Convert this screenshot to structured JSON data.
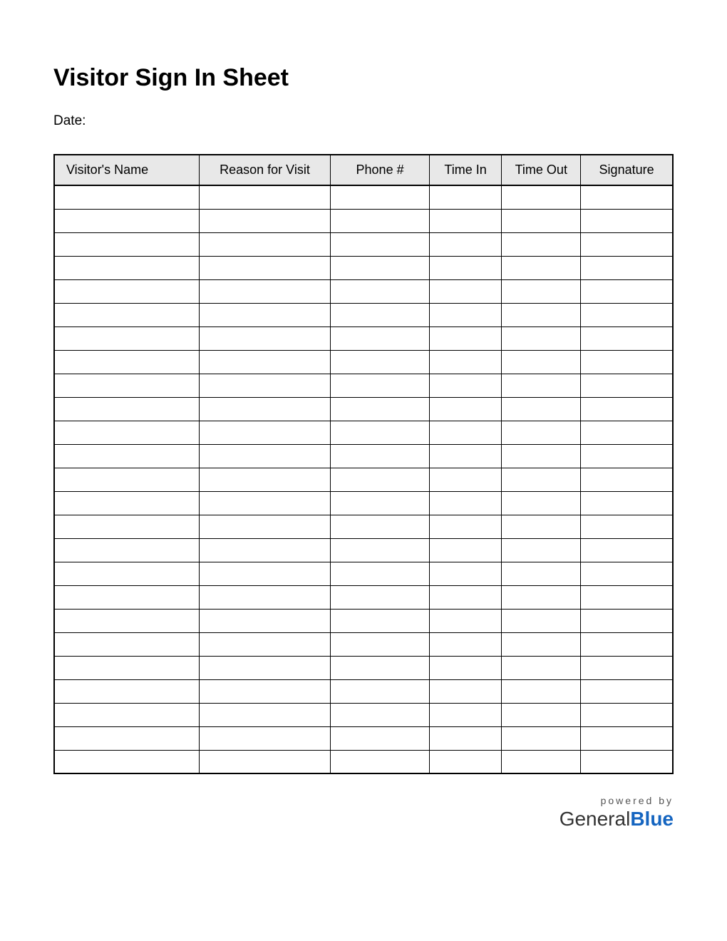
{
  "title": "Visitor Sign In Sheet",
  "date_label": "Date:",
  "columns": {
    "name": "Visitor's Name",
    "reason": "Reason for Visit",
    "phone": "Phone #",
    "time_in": "Time In",
    "time_out": "Time Out",
    "signature": "Signature"
  },
  "row_count": 25,
  "footer": {
    "powered_by": "powered by",
    "brand_part1": "General",
    "brand_part2": "Blue"
  }
}
